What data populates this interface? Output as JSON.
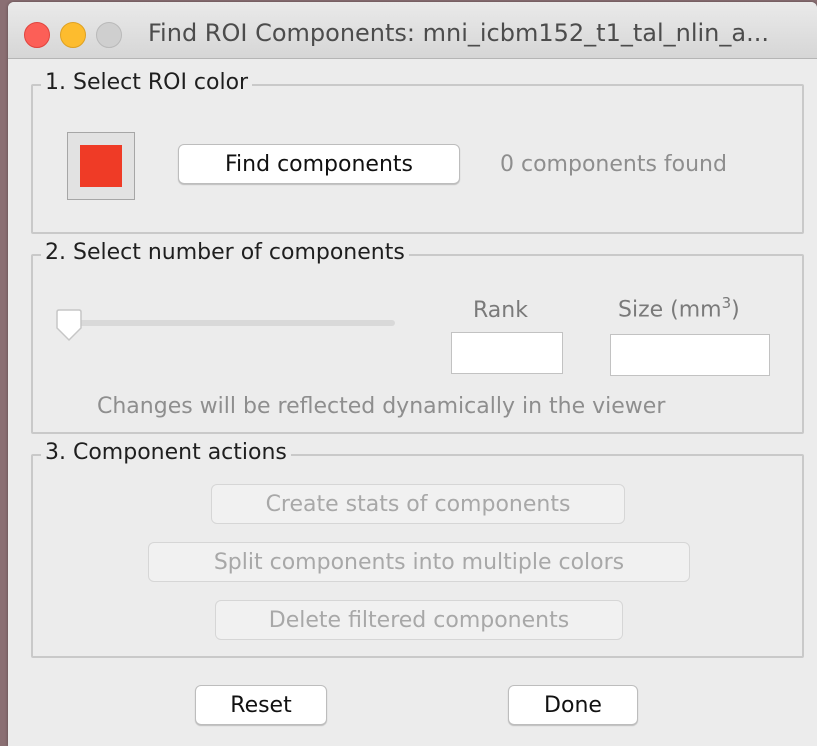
{
  "window": {
    "title": "Find ROI Components: mni_icbm152_t1_tal_nlin_a..."
  },
  "section1": {
    "legend": "1. Select ROI color",
    "roi_color": "#ef3b26",
    "find_button": "Find components",
    "status": "0 components found"
  },
  "section2": {
    "legend": "2. Select number of components",
    "slider_value": 0,
    "rank_label": "Rank",
    "size_label": "Size (mm",
    "size_label_sup": "3",
    "size_label_end": ")",
    "rank_value": "",
    "size_value": "",
    "hint": "Changes will be reflected dynamically in the viewer"
  },
  "section3": {
    "legend": "3. Component actions",
    "create_stats": "Create stats of components",
    "split_colors": "Split components into multiple colors",
    "delete_filtered": "Delete filtered components"
  },
  "footer": {
    "reset": "Reset",
    "done": "Done"
  }
}
